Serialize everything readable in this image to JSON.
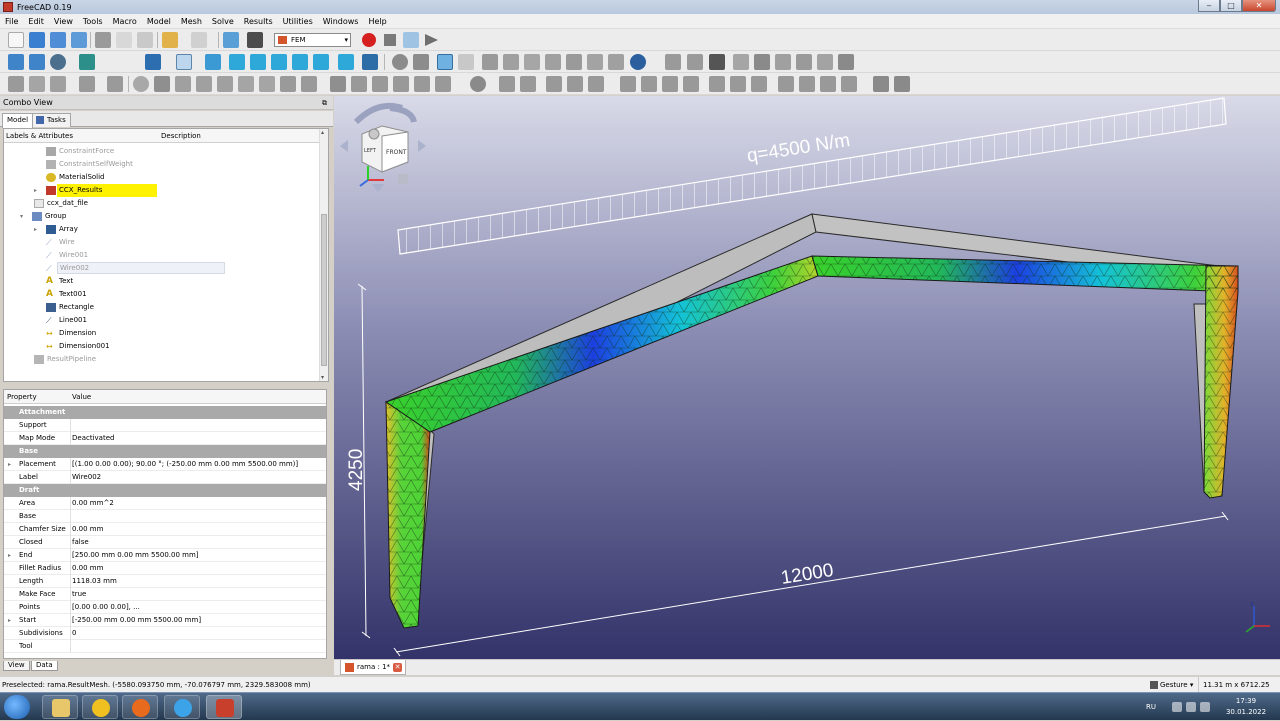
{
  "window": {
    "title": "FreeCAD 0.19",
    "minimize": "‒",
    "maximize": "□",
    "close": "✕"
  },
  "menu": [
    "File",
    "Edit",
    "View",
    "Tools",
    "Macro",
    "Model",
    "Mesh",
    "Solve",
    "Results",
    "Utilities",
    "Windows",
    "Help"
  ],
  "toolbar": {
    "workbench": "FEM"
  },
  "combo_view": {
    "title": "Combo View",
    "tabs": [
      "Model",
      "Tasks"
    ]
  },
  "tree": {
    "header": {
      "labels": "Labels & Attributes",
      "description": "Description"
    },
    "items": [
      {
        "label": "ConstraintForce",
        "state": "grey"
      },
      {
        "label": "ConstraintSelfWeight",
        "state": "grey"
      },
      {
        "label": "MaterialSolid",
        "state": "normal"
      },
      {
        "label": "CCX_Results",
        "state": "selected"
      },
      {
        "label": "ccx_dat_file",
        "state": "normal"
      },
      {
        "label": "Group",
        "state": "normal"
      },
      {
        "label": "Array",
        "state": "normal"
      },
      {
        "label": "Wire",
        "state": "grey"
      },
      {
        "label": "Wire001",
        "state": "grey"
      },
      {
        "label": "Wire002",
        "state": "hover"
      },
      {
        "label": "Text",
        "state": "normal"
      },
      {
        "label": "Text001",
        "state": "normal"
      },
      {
        "label": "Rectangle",
        "state": "normal"
      },
      {
        "label": "Line001",
        "state": "normal"
      },
      {
        "label": "Dimension",
        "state": "normal"
      },
      {
        "label": "Dimension001",
        "state": "normal"
      },
      {
        "label": "ResultPipeline",
        "state": "grey"
      }
    ]
  },
  "properties": {
    "header": {
      "property": "Property",
      "value": "Value"
    },
    "rows": [
      {
        "group": "Attachment"
      },
      {
        "name": "Support",
        "value": ""
      },
      {
        "name": "Map Mode",
        "value": "Deactivated"
      },
      {
        "group": "Base"
      },
      {
        "name": "Placement",
        "value": "[(1.00 0.00 0.00); 90.00 °; (-250.00 mm  0.00 mm  5500.00 mm)]",
        "expand": true
      },
      {
        "name": "Label",
        "value": "Wire002"
      },
      {
        "group": "Draft"
      },
      {
        "name": "Area",
        "value": "0.00 mm^2"
      },
      {
        "name": "Base",
        "value": ""
      },
      {
        "name": "Chamfer Size",
        "value": "0.00 mm"
      },
      {
        "name": "Closed",
        "value": "false"
      },
      {
        "name": "End",
        "value": "[250.00 mm  0.00 mm  5500.00 mm]",
        "expand": true
      },
      {
        "name": "Fillet Radius",
        "value": "0.00 mm"
      },
      {
        "name": "Length",
        "value": "1118.03 mm"
      },
      {
        "name": "Make Face",
        "value": "true"
      },
      {
        "name": "Points",
        "value": "[0.00 0.00 0.00], ..."
      },
      {
        "name": "Start",
        "value": "[-250.00 mm  0.00 mm  5500.00 mm]",
        "expand": true
      },
      {
        "name": "Subdivisions",
        "value": "0"
      },
      {
        "name": "Tool",
        "value": ""
      }
    ],
    "bottom_tabs": [
      "View",
      "Data"
    ]
  },
  "viewport": {
    "load_label": "q=4500 N/m",
    "height_dim": "4250",
    "span_dim": "12000",
    "navcube_front": "FRONT",
    "navcube_left": "LEFT"
  },
  "document_tab": {
    "label": "rama : 1*",
    "close": "✕"
  },
  "status": {
    "message": "Preselected: rama.ResultMesh. (-5580.093750 mm, -70.076797 mm, 2329.583008 mm)",
    "nav_style": "Gesture",
    "dimensions": "11.31 m x 6712.25 mm"
  },
  "taskbar": {
    "lang": "RU",
    "time": "17:39",
    "date": "30.01.2022"
  }
}
